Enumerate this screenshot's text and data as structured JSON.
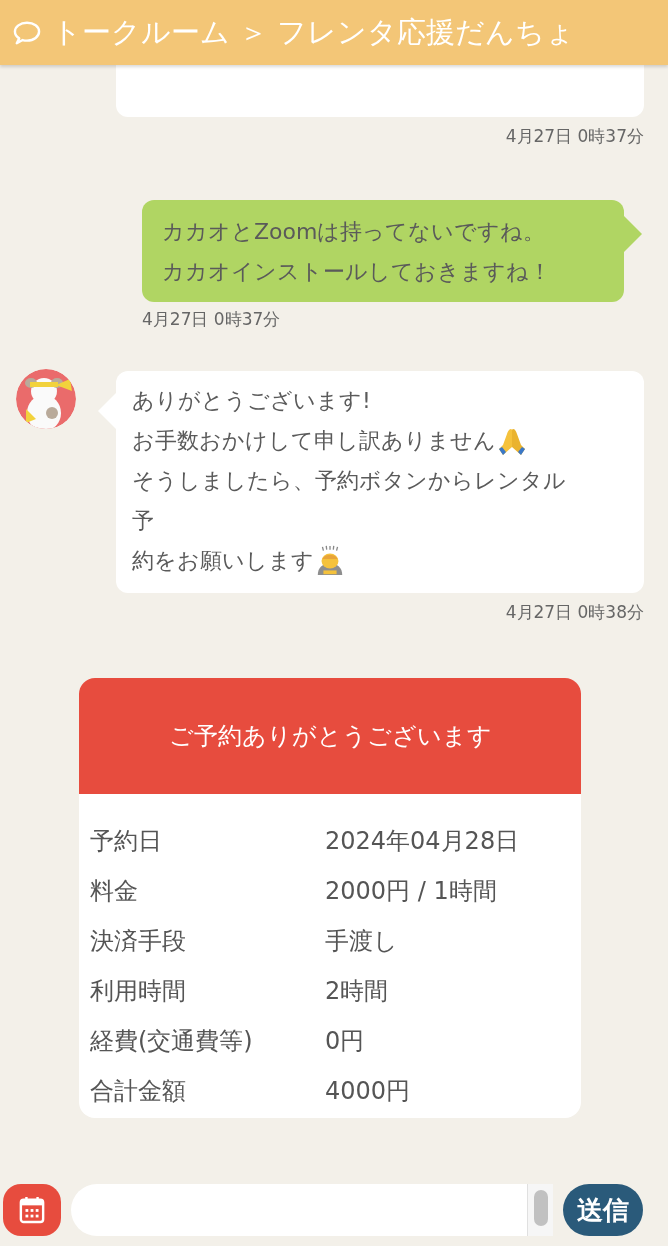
{
  "header": {
    "title": "トークルーム ＞ フレンタ応援だんちょ"
  },
  "messages": [
    {
      "kind": "cut",
      "time": "4月27日 0時37分"
    },
    {
      "kind": "sent",
      "lines": [
        {
          "kind": "plain",
          "text": "カカオとZoomは持ってないですね。"
        },
        {
          "kind": "plain",
          "text": "カカオインストールしておきますね！"
        }
      ],
      "time": "4月27日 0時37分"
    },
    {
      "kind": "avatar",
      "lines": [
        {
          "kind": "plain",
          "text": "ありがとうございます!"
        },
        {
          "kind": "pray",
          "text": "お手数おかけして申し訳ありません"
        },
        {
          "kind": "plain",
          "text": "そうしましたら、予約ボタンからレンタル"
        },
        {
          "kind": "plain",
          "text": "予"
        },
        {
          "kind": "bow",
          "text": "約をお願いします"
        }
      ],
      "time": "4月27日 0時38分"
    }
  ],
  "reservation": {
    "title": "ご予約ありがとうございます",
    "rows": [
      {
        "label": "予約日",
        "value": "2024年04月28日"
      },
      {
        "label": "料金",
        "value": "2000円 / 1時間"
      },
      {
        "label": "決済手段",
        "value": "手渡し"
      },
      {
        "label": "利用時間",
        "value": "2時間"
      },
      {
        "label": "経費(交通費等)",
        "value": "0円"
      },
      {
        "label": "合計金額",
        "value": "4000円"
      }
    ]
  },
  "composer": {
    "send_label": "送信"
  }
}
